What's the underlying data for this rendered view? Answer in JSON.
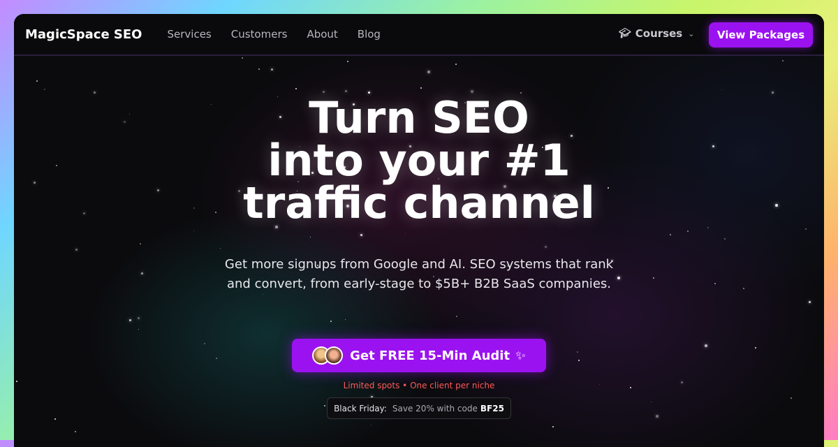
{
  "nav": {
    "logo": "MagicSpace SEO",
    "links": [
      "Services",
      "Customers",
      "About",
      "Blog"
    ],
    "courses_label": "Courses",
    "courses_icon": "graduation-cap-icon",
    "cta_label": "View Packages"
  },
  "hero": {
    "title_line1": "Turn SEO",
    "title_line2": "into your #1",
    "title_line3": "traffic channel",
    "subtitle_line1": "Get more signups from Google and AI. SEO systems that rank",
    "subtitle_line2": "and convert, from early-stage to $5B+ B2B SaaS companies.",
    "cta_label": "Get FREE 15-Min Audit",
    "cta_icon": "sparkles-icon",
    "limited_text": "Limited spots • One client per niche",
    "promo_label": "Black Friday:",
    "promo_text": "Save 20% with code",
    "promo_code": "BF25"
  },
  "colors": {
    "accent": "#9b12f0",
    "background": "#0b0b0e",
    "warning": "#ff5a5a"
  }
}
